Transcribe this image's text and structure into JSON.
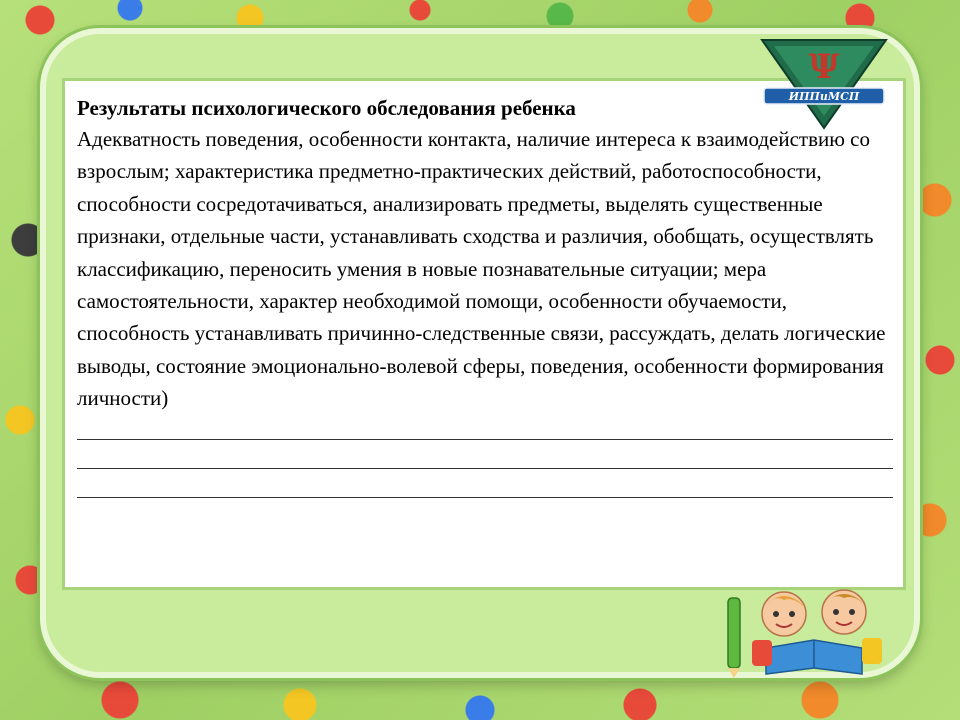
{
  "document": {
    "title": "Результаты психологического обследования ребенка",
    "body": "Адекватность поведения, особенности контакта, наличие интереса к взаимодействию со взрослым; характеристика предметно-практических действий, работоспособности, способности сосредотачиваться, анализировать предметы, выделять существенные признаки, отдельные части, устанавливать сходства и различия, обобщать, осуществлять классификацию, переносить умения в новые познавательные ситуации; мера самостоятельности, характер необходимой помощи, особенности обучаемости, способность устанавливать причинно-следственные связи, рассуждать, делать логические выводы, состояние эмоционально-волевой сферы, поведения, особенности формирования  личности)",
    "blank_lines": 3
  },
  "emblem": {
    "label": "ИППиМСП",
    "colors": {
      "triangle": "#1f6b4a",
      "banner": "#1f5fa8",
      "accent": "#c0392b"
    }
  },
  "colors": {
    "frame": "#c9ec9c",
    "panel_border": "#a7d47a",
    "background": "#a9d86c"
  }
}
